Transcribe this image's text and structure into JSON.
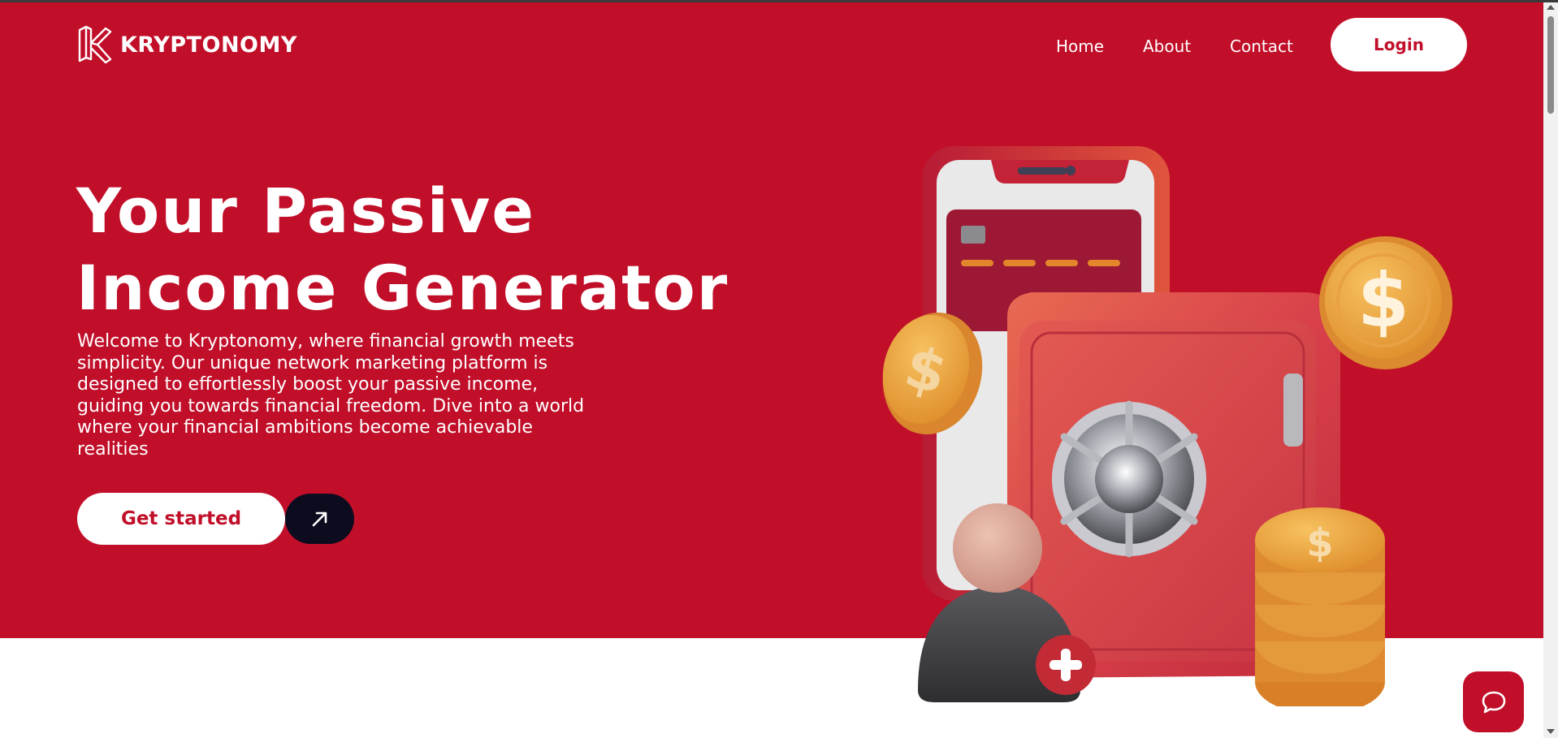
{
  "brand": {
    "name": "KRYPTONOMY",
    "logo_icon": "kryptonomy-k-logo"
  },
  "nav": {
    "items": [
      {
        "label": "Home"
      },
      {
        "label": "About"
      },
      {
        "label": "Contact"
      }
    ],
    "login_label": "Login"
  },
  "hero": {
    "headline_line1": "Your Passive",
    "headline_line2": "Income Generator",
    "description": "Welcome to Kryptonomy, where financial growth meets simplicity. Our unique network marketing platform is designed to effortlessly boost your passive income, guiding you towards financial freedom. Dive into a world where your financial ambitions become achievable realities",
    "cta_label": "Get started",
    "cta_icon": "arrow-up-right-icon"
  },
  "chat": {
    "icon": "chat-bubble-icon"
  },
  "colors": {
    "brand_red": "#c10f2a",
    "dark": "#0c0c1e",
    "white": "#ffffff",
    "coin": "#e8a33d"
  }
}
